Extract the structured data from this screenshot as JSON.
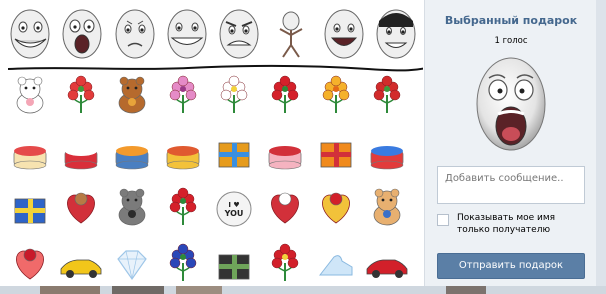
{
  "gift_panel": {
    "meme_faces": [
      {
        "icon": "trollface-icon"
      },
      {
        "icon": "omg-face-icon"
      },
      {
        "icon": "sad-face-icon"
      },
      {
        "icon": "grin-face-icon"
      },
      {
        "icon": "rage-face-icon"
      },
      {
        "icon": "forever-alone-icon"
      },
      {
        "icon": "happy-face-icon"
      },
      {
        "icon": "yao-ming-icon"
      }
    ],
    "gifts": [
      {
        "icon": "white-kitten-icon"
      },
      {
        "icon": "flower-bouquet-icon"
      },
      {
        "icon": "teddy-bear-flowers-icon"
      },
      {
        "icon": "pink-orchid-icon"
      },
      {
        "icon": "daisy-bouquet-icon"
      },
      {
        "icon": "red-rose-icon"
      },
      {
        "icon": "lily-icon"
      },
      {
        "icon": "red-bouquet-icon"
      },
      {
        "icon": "fruit-cake-icon"
      },
      {
        "icon": "red-cake-icon"
      },
      {
        "icon": "vk-birthday-cake-icon"
      },
      {
        "icon": "yellow-cake-icon"
      },
      {
        "icon": "gift-box-icon"
      },
      {
        "icon": "strawberry-cake-icon"
      },
      {
        "icon": "orange-gift-box-icon"
      },
      {
        "icon": "rainbow-cake-icon"
      },
      {
        "icon": "blue-book-icon"
      },
      {
        "icon": "teddy-bear-heart-icon"
      },
      {
        "icon": "raccoon-icon"
      },
      {
        "icon": "rose-bouquet-icon"
      },
      {
        "icon": "i-love-you-badge-icon"
      },
      {
        "icon": "panda-heart-icon"
      },
      {
        "icon": "heart-key-icon"
      },
      {
        "icon": "hamster-icon"
      },
      {
        "icon": "ruby-heart-icon"
      },
      {
        "icon": "yellow-sports-car-icon"
      },
      {
        "icon": "diamond-icon"
      },
      {
        "icon": "blue-flowers-icon"
      },
      {
        "icon": "money-case-icon"
      },
      {
        "icon": "ring-box-icon"
      },
      {
        "icon": "glass-slipper-icon"
      },
      {
        "icon": "red-sports-car-icon"
      }
    ],
    "badge_text": "I LOVE YOU"
  },
  "sidebar": {
    "title": "Выбранный подарок",
    "votes": "1 голос",
    "preview_icon": "omg-face-icon",
    "message_placeholder": "Добавить сообщение..",
    "checkbox_label": "Показывать мое имя только получателю",
    "submit_label": "Отправить подарок"
  },
  "colors": {
    "sidebar_bg": "#edf1f5",
    "title": "#45688e",
    "button": "#5b7fa6"
  }
}
